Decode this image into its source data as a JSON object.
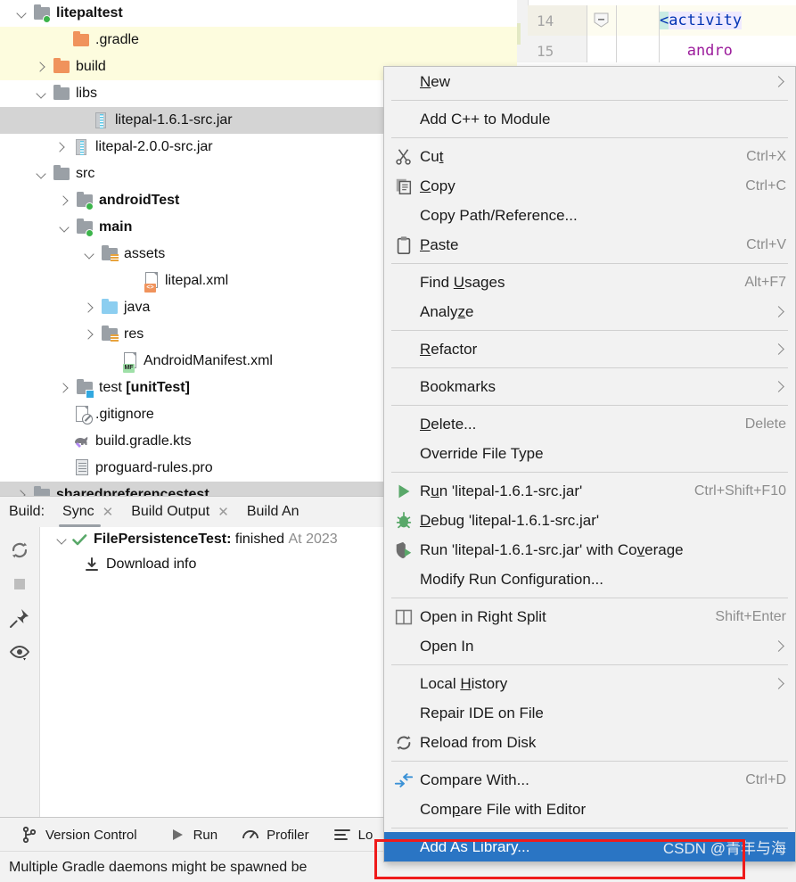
{
  "editor": {
    "lines": [
      {
        "number": "14",
        "code_brk": "<",
        "code_tag": "activity",
        "code_rest": ""
      },
      {
        "number": "15",
        "code_brk": "",
        "code_tag": "",
        "code_rest": "andro"
      }
    ],
    "line14_text": "<activity",
    "line15_text": "andro"
  },
  "tree": {
    "items": [
      {
        "label": "litepaltest",
        "indent": 36,
        "twisty": "down",
        "icon": "folder-module",
        "bold": true,
        "state": "normal"
      },
      {
        "label": ".gradle",
        "indent": 80,
        "twisty": "none",
        "icon": "folder-orange",
        "bold": false,
        "state": "excluded"
      },
      {
        "label": "build",
        "indent": 58,
        "twisty": "right",
        "icon": "folder-orange",
        "bold": false,
        "state": "excluded"
      },
      {
        "label": "libs",
        "indent": 58,
        "twisty": "down",
        "icon": "folder-gray",
        "bold": false,
        "state": "normal"
      },
      {
        "label": "litepal-1.6.1-src.jar",
        "indent": 102,
        "twisty": "none",
        "icon": "jar",
        "bold": false,
        "state": "selected"
      },
      {
        "label": "litepal-2.0.0-src.jar",
        "indent": 80,
        "twisty": "right",
        "icon": "jar",
        "bold": false,
        "state": "normal"
      },
      {
        "label": "src",
        "indent": 58,
        "twisty": "down",
        "icon": "folder-gray",
        "bold": false,
        "state": "normal"
      },
      {
        "label": "androidTest",
        "indent": 84,
        "twisty": "right",
        "icon": "folder-source",
        "bold": true,
        "state": "normal"
      },
      {
        "label": "main",
        "indent": 84,
        "twisty": "down",
        "icon": "folder-source",
        "bold": true,
        "state": "normal"
      },
      {
        "label": "assets",
        "indent": 112,
        "twisty": "down",
        "icon": "folder-assets",
        "bold": false,
        "state": "normal"
      },
      {
        "label": "litepal.xml",
        "indent": 158,
        "twisty": "none",
        "icon": "file-xml",
        "bold": false,
        "state": "normal"
      },
      {
        "label": "java",
        "indent": 112,
        "twisty": "right",
        "icon": "folder-blue",
        "bold": false,
        "state": "normal"
      },
      {
        "label": "res",
        "indent": 112,
        "twisty": "right",
        "icon": "folder-assets",
        "bold": false,
        "state": "normal"
      },
      {
        "label": "AndroidManifest.xml",
        "indent": 134,
        "twisty": "none",
        "icon": "file-manifest",
        "bold": false,
        "state": "normal"
      },
      {
        "label": "test [unitTest]",
        "indent": 84,
        "twisty": "right",
        "icon": "folder-test",
        "bold": false,
        "state": "normal",
        "bold_tail": "[unitTest]"
      },
      {
        "label": ".gitignore",
        "indent": 80,
        "twisty": "none",
        "icon": "file-gitignore",
        "bold": false,
        "state": "normal"
      },
      {
        "label": "build.gradle.kts",
        "indent": 80,
        "twisty": "none",
        "icon": "file-gradle",
        "bold": false,
        "state": "normal"
      },
      {
        "label": "proguard-rules.pro",
        "indent": 80,
        "twisty": "none",
        "icon": "file-pro",
        "bold": false,
        "state": "normal"
      },
      {
        "label": "sharedpreferencestest",
        "indent": 36,
        "twisty": "right",
        "icon": "folder-module",
        "bold": true,
        "state": "partial"
      }
    ]
  },
  "build_panel": {
    "title": "Build:",
    "tabs": [
      {
        "label": "Sync",
        "closable": true,
        "active": true
      },
      {
        "label": "Build Output",
        "closable": true,
        "active": false
      },
      {
        "label": "Build An",
        "closable": false,
        "active": false
      }
    ],
    "side_icons": [
      "rerun-icon",
      "stop-icon",
      "pin-icon",
      "eye-filter-icon"
    ],
    "result": {
      "name": "FilePersistenceTest:",
      "status": "finished",
      "timestamp": "At 2023",
      "child": "Download info"
    }
  },
  "tool_window_bar": {
    "items": [
      {
        "label": "Version Control",
        "icon": "branch-icon"
      },
      {
        "label": "Run",
        "icon": "play-icon"
      },
      {
        "label": "Profiler",
        "icon": "gauge-icon"
      },
      {
        "label": "Lo",
        "icon": "logcat-icon"
      }
    ]
  },
  "status_bar": {
    "message": "Multiple Gradle daemons might be spawned be"
  },
  "context_menu": {
    "watermark": "CSDN @青年与海",
    "items": [
      {
        "type": "item",
        "label": "New",
        "mnemonic": "N",
        "icon": "",
        "shortcut": "",
        "submenu": true
      },
      {
        "type": "sep"
      },
      {
        "type": "item",
        "label": "Add C++ to Module",
        "mnemonic": "",
        "icon": "",
        "shortcut": "",
        "submenu": false
      },
      {
        "type": "sep"
      },
      {
        "type": "item",
        "label": "Cut",
        "mnemonic": "t",
        "icon": "scissors-icon",
        "shortcut": "Ctrl+X",
        "submenu": false
      },
      {
        "type": "item",
        "label": "Copy",
        "mnemonic": "C",
        "icon": "copy-icon",
        "shortcut": "Ctrl+C",
        "submenu": false
      },
      {
        "type": "item",
        "label": "Copy Path/Reference...",
        "mnemonic": "",
        "icon": "",
        "shortcut": "",
        "submenu": false
      },
      {
        "type": "item",
        "label": "Paste",
        "mnemonic": "P",
        "icon": "clipboard-icon",
        "shortcut": "Ctrl+V",
        "submenu": false
      },
      {
        "type": "sep"
      },
      {
        "type": "item",
        "label": "Find Usages",
        "mnemonic": "U",
        "icon": "",
        "shortcut": "Alt+F7",
        "submenu": false
      },
      {
        "type": "item",
        "label": "Analyze",
        "mnemonic": "z",
        "icon": "",
        "shortcut": "",
        "submenu": true
      },
      {
        "type": "sep"
      },
      {
        "type": "item",
        "label": "Refactor",
        "mnemonic": "R",
        "icon": "",
        "shortcut": "",
        "submenu": true
      },
      {
        "type": "sep"
      },
      {
        "type": "item",
        "label": "Bookmarks",
        "mnemonic": "",
        "icon": "",
        "shortcut": "",
        "submenu": true
      },
      {
        "type": "sep"
      },
      {
        "type": "item",
        "label": "Delete...",
        "mnemonic": "D",
        "icon": "",
        "shortcut": "Delete",
        "submenu": false
      },
      {
        "type": "item",
        "label": "Override File Type",
        "mnemonic": "",
        "icon": "",
        "shortcut": "",
        "submenu": false
      },
      {
        "type": "sep"
      },
      {
        "type": "item",
        "label": "Run 'litepal-1.6.1-src.jar'",
        "mnemonic": "u",
        "icon": "run-icon",
        "shortcut": "Ctrl+Shift+F10",
        "submenu": false
      },
      {
        "type": "item",
        "label": "Debug 'litepal-1.6.1-src.jar'",
        "mnemonic": "D",
        "icon": "debug-icon",
        "shortcut": "",
        "submenu": false
      },
      {
        "type": "item",
        "label": "Run 'litepal-1.6.1-src.jar' with Coverage",
        "mnemonic": "v",
        "icon": "coverage-icon",
        "shortcut": "",
        "submenu": false
      },
      {
        "type": "item",
        "label": "Modify Run Configuration...",
        "mnemonic": "",
        "icon": "",
        "shortcut": "",
        "submenu": false
      },
      {
        "type": "sep"
      },
      {
        "type": "item",
        "label": "Open in Right Split",
        "mnemonic": "",
        "icon": "split-icon",
        "shortcut": "Shift+Enter",
        "submenu": false
      },
      {
        "type": "item",
        "label": "Open In",
        "mnemonic": "",
        "icon": "",
        "shortcut": "",
        "submenu": true
      },
      {
        "type": "sep"
      },
      {
        "type": "item",
        "label": "Local History",
        "mnemonic": "H",
        "icon": "",
        "shortcut": "",
        "submenu": true
      },
      {
        "type": "item",
        "label": "Repair IDE on File",
        "mnemonic": "",
        "icon": "",
        "shortcut": "",
        "submenu": false
      },
      {
        "type": "item",
        "label": "Reload from Disk",
        "mnemonic": "",
        "icon": "reload-icon",
        "shortcut": "",
        "submenu": false
      },
      {
        "type": "sep"
      },
      {
        "type": "item",
        "label": "Compare With...",
        "mnemonic": "",
        "icon": "compare-icon",
        "shortcut": "Ctrl+D",
        "submenu": false
      },
      {
        "type": "item",
        "label": "Compare File with Editor",
        "mnemonic": "p",
        "icon": "",
        "shortcut": "",
        "submenu": false
      },
      {
        "type": "sep"
      },
      {
        "type": "item",
        "label": "Add As Library...",
        "mnemonic": "",
        "icon": "",
        "shortcut": "",
        "submenu": false,
        "selected": true
      }
    ]
  },
  "colors": {
    "selection_blue": "#2a75c4",
    "highlight_red": "#ef1b1b",
    "excluded_yellow": "#fdfcde",
    "tree_selected_gray": "#d4d4d4",
    "menu_bg": "#f2f2f2",
    "green_run": "#59a869"
  }
}
